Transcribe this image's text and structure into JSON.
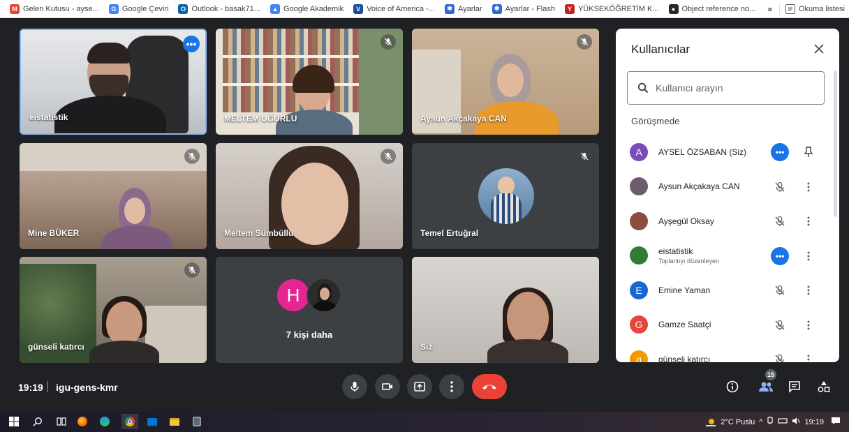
{
  "bookmarks": [
    {
      "label": "Gelen Kutusu - ayse...",
      "icon": "gmail-icon",
      "color": "#ea4335",
      "glyph": "M"
    },
    {
      "label": "Google Çeviri",
      "icon": "translate-icon",
      "color": "#4285f4",
      "glyph": "G"
    },
    {
      "label": "Outlook - basak71...",
      "icon": "outlook-icon",
      "color": "#0a64ad",
      "glyph": "O"
    },
    {
      "label": "Google Akademik",
      "icon": "scholar-icon",
      "color": "#4285f4",
      "glyph": "▲"
    },
    {
      "label": "Voice of America -...",
      "icon": "voa-icon",
      "color": "#1a4e9a",
      "glyph": "V"
    },
    {
      "label": "Ayarlar",
      "icon": "settings-icon",
      "color": "#3367d6",
      "glyph": "✱"
    },
    {
      "label": "Ayarlar - Flash",
      "icon": "settings-icon",
      "color": "#3367d6",
      "glyph": "✱"
    },
    {
      "label": "YÜKSEKÖĞRETİM K...",
      "icon": "yok-icon",
      "color": "#c5221f",
      "glyph": "Y"
    },
    {
      "label": "Object reference no...",
      "icon": "github-icon",
      "color": "#24292e",
      "glyph": "●"
    }
  ],
  "bookmarks_more": "»",
  "reading_list": "Okuma listesi",
  "tiles": [
    {
      "name": "eistatistik",
      "state": "dots"
    },
    {
      "name": "MELTEM UĞURLU",
      "state": "muted"
    },
    {
      "name": "Aysun Akçakaya CAN",
      "state": "muted"
    },
    {
      "name": "Mine BÜKER",
      "state": "muted"
    },
    {
      "name": "Meltem Sümbüllü",
      "state": "muted"
    },
    {
      "name": "Temel Ertuğral",
      "state": "muted"
    },
    {
      "name": "günseli katırcı",
      "state": "muted"
    },
    {
      "name": "7 kişi daha",
      "state": "none",
      "avatar_letter": "H"
    },
    {
      "name": "Siz",
      "state": "none"
    }
  ],
  "panel": {
    "title": "Kullanıcılar",
    "search_placeholder": "Kullanıcı arayın",
    "section": "Görüşmede",
    "participants": [
      {
        "name": "AYSEL ÖZSABAN (Siz)",
        "letter": "A",
        "color": "#7b4bb7",
        "action": "dots",
        "extra": "pin"
      },
      {
        "name": "Aysun Akçakaya CAN",
        "letter": "",
        "color": "#6d5a6e",
        "action": "muted",
        "extra": "more"
      },
      {
        "name": "Ayşegül Oksay",
        "letter": "",
        "color": "#8a4f3c",
        "action": "muted",
        "extra": "more"
      },
      {
        "name": "eistatistik",
        "sub": "Toplantıyı düzenleyen",
        "letter": "",
        "color": "#2e7d32",
        "action": "dots",
        "extra": "more"
      },
      {
        "name": "Emine Yaman",
        "letter": "E",
        "color": "#1967d2",
        "action": "muted",
        "extra": "more"
      },
      {
        "name": "Gamze Saatçi",
        "letter": "G",
        "color": "#e8453c",
        "action": "muted",
        "extra": "more"
      },
      {
        "name": "günseli katırcı",
        "letter": "g",
        "color": "#f29900",
        "action": "muted",
        "extra": "more"
      }
    ]
  },
  "bottom": {
    "time": "19:19",
    "separator": "|",
    "meeting_code": "igu-gens-kmr",
    "participant_count": "15"
  },
  "taskbar": {
    "weather": "2°C  Puslu",
    "clock": "19:19"
  }
}
